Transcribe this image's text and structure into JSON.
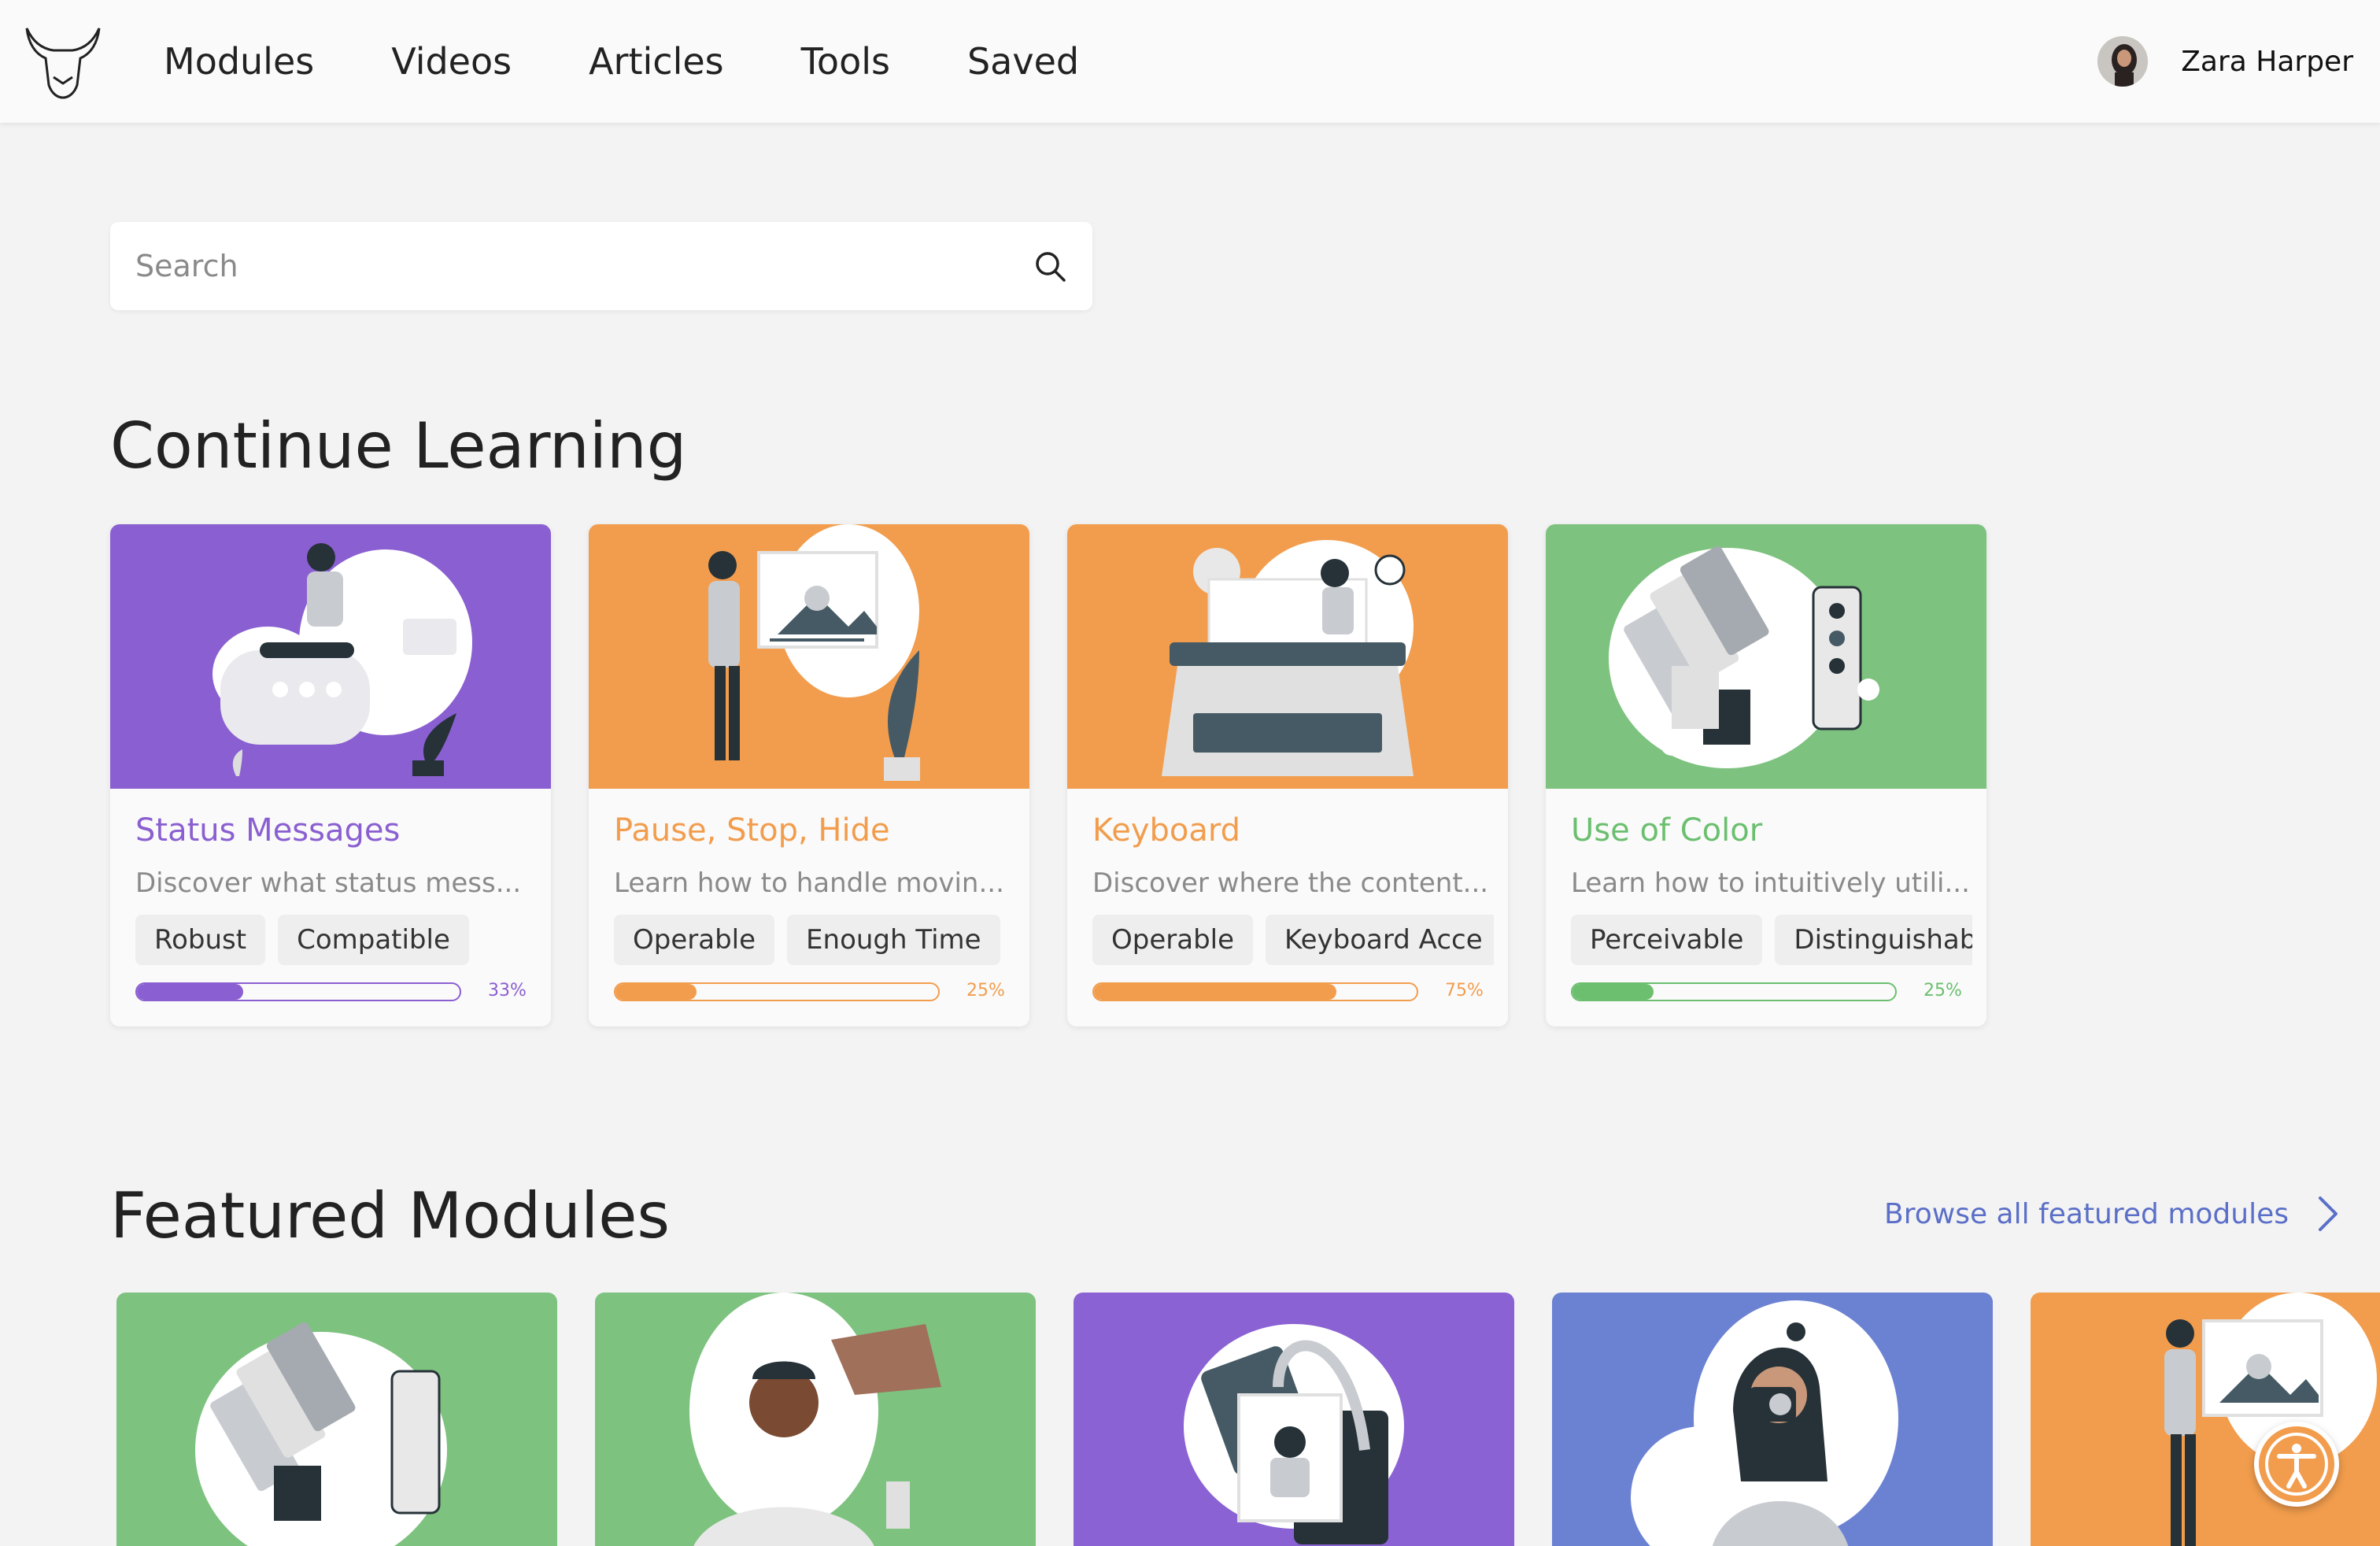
{
  "nav": {
    "items": [
      "Modules",
      "Videos",
      "Articles",
      "Tools",
      "Saved"
    ]
  },
  "user": {
    "name": "Zara Harper"
  },
  "search": {
    "placeholder": "Search",
    "value": ""
  },
  "continue_learning": {
    "title": "Continue Learning",
    "cards": [
      {
        "title": "Status Messages",
        "description": "Discover what status mess...",
        "tags": [
          "Robust",
          "Compatible"
        ],
        "progress_label": "33%",
        "progress": 33,
        "color": "#8a5fd1"
      },
      {
        "title": "Pause, Stop, Hide",
        "description": "Learn how to handle movin...",
        "tags": [
          "Operable",
          "Enough Time"
        ],
        "progress_label": "25%",
        "progress": 25,
        "color": "#f29d4d"
      },
      {
        "title": "Keyboard",
        "description": "Discover where the content...",
        "tags": [
          "Operable",
          "Keyboard Acce"
        ],
        "progress_label": "75%",
        "progress": 75,
        "color": "#f29d4d"
      },
      {
        "title": "Use of Color",
        "description": "Learn how to intuitively utili...",
        "tags": [
          "Perceivable",
          "Distinguishab"
        ],
        "progress_label": "25%",
        "progress": 25,
        "color": "#6bbf6f"
      }
    ]
  },
  "featured": {
    "title": "Featured Modules",
    "browse_label": "Browse all featured modules",
    "cards": [
      {
        "color": "#7dc27f"
      },
      {
        "color": "#7dc27f"
      },
      {
        "color": "#8a62d3"
      },
      {
        "color": "#6b82d3"
      },
      {
        "color": "#f29d4d"
      }
    ]
  },
  "colors": {
    "accent_link": "#5b6fc8",
    "background": "#f3f3f3"
  }
}
